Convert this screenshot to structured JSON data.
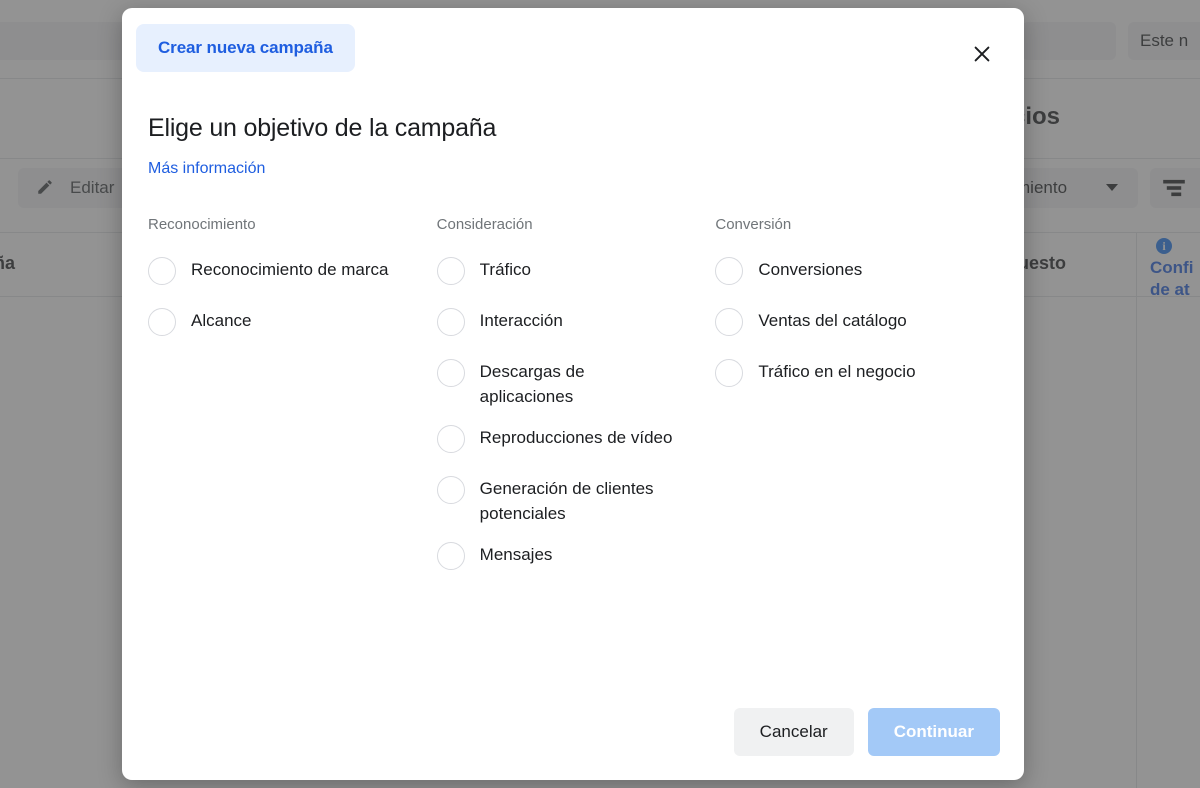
{
  "background": {
    "edit_button_label": "Editar",
    "edit_icon": "pencil-icon",
    "left_truncated_label": "ña",
    "right_chip_label": "Este n",
    "section_title": "cios",
    "dropdown_label": "miento",
    "sort_icon": "sort-descending-icon",
    "column_label": "uesto",
    "info_icon": "info-icon",
    "info_title": "Confi",
    "info_subtitle": "de at"
  },
  "modal": {
    "tab_label": "Crear nueva campaña",
    "close_icon": "close-icon",
    "heading": "Elige un objetivo de la campaña",
    "more_info_link": "Más información",
    "columns": [
      {
        "title": "Reconocimiento",
        "options": [
          {
            "label": "Reconocimiento de marca",
            "selected": false
          },
          {
            "label": "Alcance",
            "selected": false
          }
        ]
      },
      {
        "title": "Consideración",
        "options": [
          {
            "label": "Tráfico",
            "selected": false
          },
          {
            "label": "Interacción",
            "selected": false
          },
          {
            "label": "Descargas de aplicaciones",
            "selected": false
          },
          {
            "label": "Reproducciones de vídeo",
            "selected": false
          },
          {
            "label": "Generación de clientes potenciales",
            "selected": false
          },
          {
            "label": "Mensajes",
            "selected": false
          }
        ]
      },
      {
        "title": "Conversión",
        "options": [
          {
            "label": "Conversiones",
            "selected": false
          },
          {
            "label": "Ventas del catálogo",
            "selected": false
          },
          {
            "label": "Tráfico en el negocio",
            "selected": false
          }
        ]
      }
    ],
    "footer": {
      "cancel_label": "Cancelar",
      "continue_label": "Continuar",
      "continue_disabled": true
    }
  },
  "colors": {
    "accent_blue": "#1f5ee0",
    "tab_pill_bg": "#e7f0fe",
    "continue_disabled_bg": "#a3c9f7",
    "cancel_bg": "#f0f1f2",
    "overlay": "#808080",
    "info_icon_blue": "#1877f2"
  }
}
